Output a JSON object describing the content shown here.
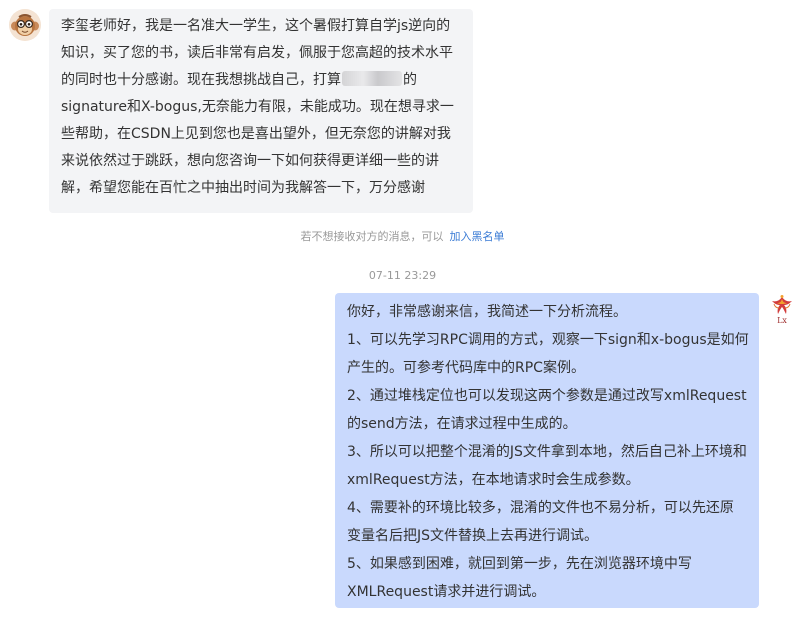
{
  "received": {
    "lines": [
      "李玺老师好，我是一名准大一学生，这个暑假打算自学js逆向的",
      "知识，买了您的书，读后非常有启发，佩服于您高超的技术水平",
      "的同时也十分感谢。现在我想挑战自己，打算",
      "signature和X-bogus,无奈能力有限，未能成功。现在想寻求一",
      "些帮助，在CSDN上见到您也是喜出望外，但无奈您的讲解对我",
      "来说依然过于跳跃，想向您咨询一下如何获得更详细一些的讲",
      "解，希望您能在百忙之中抽出时间为我解答一下，万分感谢"
    ],
    "line3_after_blur": "的"
  },
  "notice": {
    "text": "若不想接收对方的消息，可以",
    "link": "加入黑名单"
  },
  "timestamp": "07-11 23:29",
  "sent": {
    "lines": [
      "你好，非常感谢来信，我简述一下分析流程。",
      "1、可以先学习RPC调用的方式，观察一下sign和x-bogus是如何",
      "产生的。可参考代码库中的RPC案例。",
      "2、通过堆栈定位也可以发现这两个参数是通过改写xmlRequest",
      "的send方法，在请求过程中生成的。",
      "3、所以可以把整个混淆的JS文件拿到本地，然后自己补上环境和",
      "xmlRequest方法，在本地请求时会生成参数。",
      "4、需要补的环境比较多，混淆的文件也不易分析，可以先还原",
      "变量名后把JS文件替换上去再进行调试。",
      "5、如果感到困难，就回到第一步，先在浏览器环境中写",
      "XMLRequest请求并进行调试。"
    ]
  },
  "avatars": {
    "sender_icon": "monkey-avatar-icon",
    "me_icon": "phoenix-logo-icon",
    "me_label": "Lx"
  }
}
